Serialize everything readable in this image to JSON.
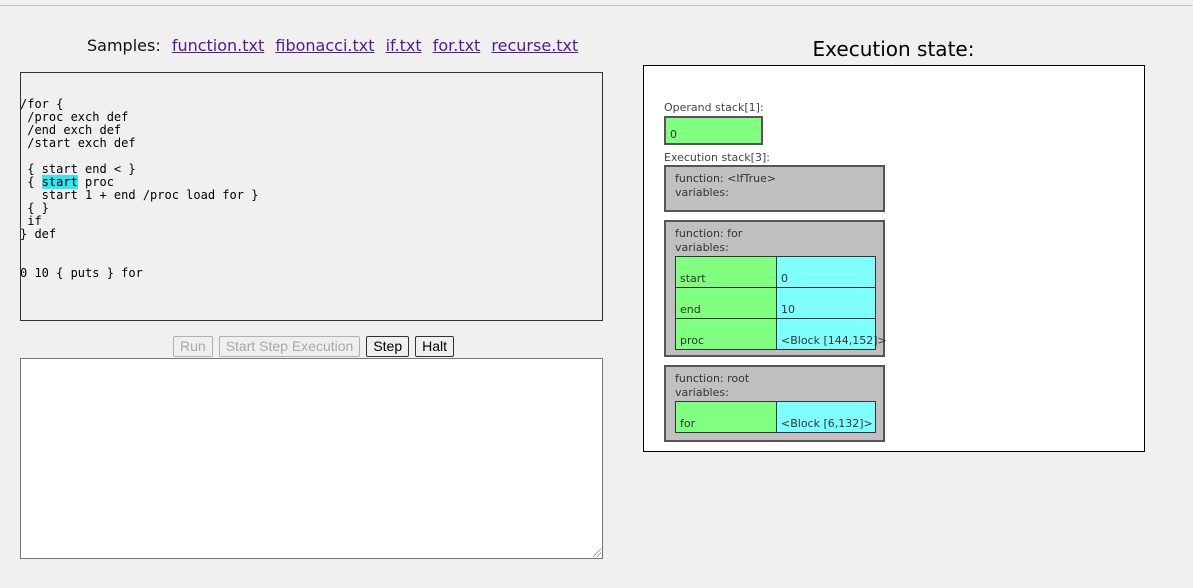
{
  "samples": {
    "label": "Samples:",
    "links": [
      "function.txt",
      "fibonacci.txt",
      "if.txt",
      "for.txt",
      "recurse.txt"
    ]
  },
  "editor": {
    "code_before": "/for {\n /proc exch def\n /end exch def\n /start exch def\n\n { start end < }\n { ",
    "highlight": "start",
    "code_after": " proc\n   start 1 + end /proc load for }\n { }\n if\n} def\n\n\n0 10 { puts } for"
  },
  "buttons": {
    "run": "Run",
    "start_step": "Start Step Execution",
    "step": "Step",
    "halt": "Halt"
  },
  "output": {
    "value": ""
  },
  "state": {
    "title": "Execution state:",
    "operand_label": "Operand stack[1]:",
    "operand_values": [
      "0"
    ],
    "exec_label": "Execution stack[3]:",
    "frames": [
      {
        "function": "function: <IfTrue>",
        "variables_label": "variables:",
        "vars": []
      },
      {
        "function": "function: for",
        "variables_label": "variables:",
        "vars": [
          {
            "name": "start",
            "value": "0"
          },
          {
            "name": "end",
            "value": "10"
          },
          {
            "name": "proc",
            "value": "<Block [144,152]>"
          }
        ]
      },
      {
        "function": "function: root",
        "variables_label": "variables:",
        "vars": [
          {
            "name": "for",
            "value": "<Block [6,132]>"
          }
        ]
      }
    ]
  },
  "colors": {
    "key_bg": "#80ff80",
    "value_bg": "#80ffff",
    "frame_bg": "#c0c0c0",
    "highlight": "#33e6f0"
  }
}
